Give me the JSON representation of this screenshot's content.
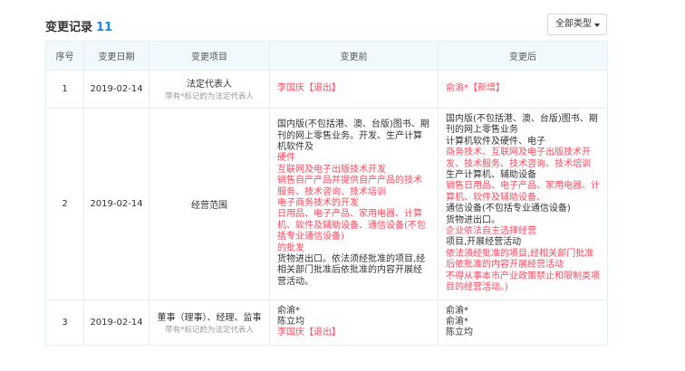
{
  "header": {
    "title": "变更记录",
    "count": "11",
    "filter_label": "全部类型"
  },
  "table": {
    "columns": [
      "序号",
      "变更日期",
      "变更项目",
      "变更前",
      "变更后"
    ],
    "rows": [
      {
        "index": "1",
        "date": "2019-02-14",
        "item": "法定代表人",
        "item_note": "带有*标记的为法定代表人",
        "before": [
          {
            "text": "李国庆【退出】",
            "highlight": true
          }
        ],
        "after": [
          {
            "text": "俞渝*【新增】",
            "highlight": true
          }
        ]
      },
      {
        "index": "2",
        "date": "2019-02-14",
        "item": "经营范围",
        "item_note": "",
        "before": [
          {
            "text": "国内版(不包括港、澳、台版)图书、期刊的网上零售业务。开发、生产计算机软件及",
            "highlight": false
          },
          {
            "text": "硬件",
            "highlight": true
          },
          {
            "text": "互联网及电子出版技术开发",
            "highlight": true
          },
          {
            "text": "销售自产产品并提供自产产品的技术服务、技术咨询、技术培训",
            "highlight": true
          },
          {
            "text": "电子商务技术的开发",
            "highlight": true
          },
          {
            "text": "日用品、电子产品、家用电器、计算机、软件及辅助设备、通信设备(不包括专业通信设备)",
            "highlight": true
          },
          {
            "text": "的批发",
            "highlight": true
          },
          {
            "text": "货物进出口。依法须经批准的项目,经相关部门批准后依批准的内容开展经营活动。",
            "highlight": false
          }
        ],
        "after": [
          {
            "text": "国内版(不包括港、澳、台版)图书、期刊的网上零售业务",
            "highlight": false
          },
          {
            "text": "计算机软件及硬件、电子",
            "highlight": false
          },
          {
            "text": "商务技术、互联网及电子出版技术开发、技术服务、技术咨询、技术培训",
            "highlight": true
          },
          {
            "text": "生产计算机、辅助设备",
            "highlight": false
          },
          {
            "text": "销售日用品、电子产品、家用电器、计算机、软件及辅助设备、",
            "highlight": true
          },
          {
            "text": "通信设备(不包括专业通信设备)",
            "highlight": false
          },
          {
            "text": "货物进出口。",
            "highlight": false
          },
          {
            "text": "企业依法自主选择经营",
            "highlight": true
          },
          {
            "text": "项目,开展经营活动",
            "highlight": false
          },
          {
            "text": "依法须经批准的项目,经相关部门批准后依批准的内容开展经营活动",
            "highlight": true
          },
          {
            "text": "不得从事本市产业政策禁止和限制类项目的经营活动。)",
            "highlight": true
          }
        ]
      },
      {
        "index": "3",
        "date": "2019-02-14",
        "item": "董事（理事）、经理、监事",
        "item_note": "带有*标记的为法定代表人",
        "before": [
          {
            "text": "俞渝*",
            "highlight": false
          },
          {
            "text": "陈立均",
            "highlight": false
          },
          {
            "text": "李国庆【退出】",
            "highlight": true
          }
        ],
        "after": [
          {
            "text": "俞渝*",
            "highlight": false
          },
          {
            "text": "俞渝*",
            "highlight": false
          },
          {
            "text": "陈立均",
            "highlight": false
          }
        ]
      }
    ]
  },
  "colors": {
    "accent": "#128bed",
    "highlight": "#fd485e",
    "header_bg": "#f2f9fc",
    "border": "#e4eef6"
  }
}
